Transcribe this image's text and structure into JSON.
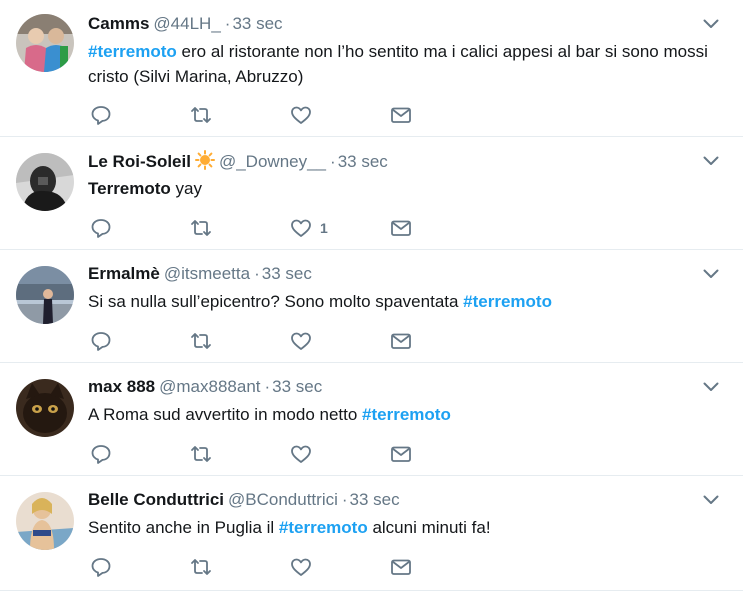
{
  "tweets": [
    {
      "name": "Camms",
      "handle": "@44LH_",
      "separator": "·",
      "time": "33 sec",
      "segments": [
        {
          "t": "#terremoto",
          "s": "tag"
        },
        {
          "t": " ero al ristorante non l’ho sentito ma i calici appesi al bar si sono mossi cristo (Silvi Marina, Abruzzo)",
          "s": ""
        }
      ],
      "like_count": ""
    },
    {
      "name": "Le Roi-Soleil",
      "handle": "@_Downey__",
      "separator": "·",
      "time": "33 sec",
      "segments": [
        {
          "t": "Terremoto",
          "s": "bold"
        },
        {
          "t": " yay",
          "s": ""
        }
      ],
      "like_count": "1"
    },
    {
      "name": "Ermalmè",
      "handle": "@itsmeetta",
      "separator": "·",
      "time": "33 sec",
      "segments": [
        {
          "t": "Si sa nulla sull’epicentro? Sono molto spaventata ",
          "s": ""
        },
        {
          "t": "#terremoto",
          "s": "tag"
        }
      ],
      "like_count": ""
    },
    {
      "name": "max 888",
      "handle": "@max888ant",
      "separator": "·",
      "time": "33 sec",
      "segments": [
        {
          "t": "A Roma sud avvertito in modo netto ",
          "s": ""
        },
        {
          "t": "#terremoto",
          "s": "tag"
        }
      ],
      "like_count": ""
    },
    {
      "name": "Belle Conduttrici",
      "handle": "@BConduttrici",
      "separator": "·",
      "time": "33 sec",
      "segments": [
        {
          "t": "Sentito anche in Puglia il ",
          "s": ""
        },
        {
          "t": "#terremoto",
          "s": "tag"
        },
        {
          "t": " alcuni minuti fa!",
          "s": ""
        }
      ],
      "like_count": ""
    }
  ],
  "icons": {
    "reply": "reply-icon",
    "retweet": "retweet-icon",
    "like": "like-icon",
    "message": "message-icon",
    "caret": "chevron-down-icon",
    "emoji": "sun-icon"
  },
  "colors": {
    "hashtag": "#1da1f2",
    "secondary_text": "#657786",
    "divider": "#e6ecf0",
    "sun": "#ffac33"
  }
}
